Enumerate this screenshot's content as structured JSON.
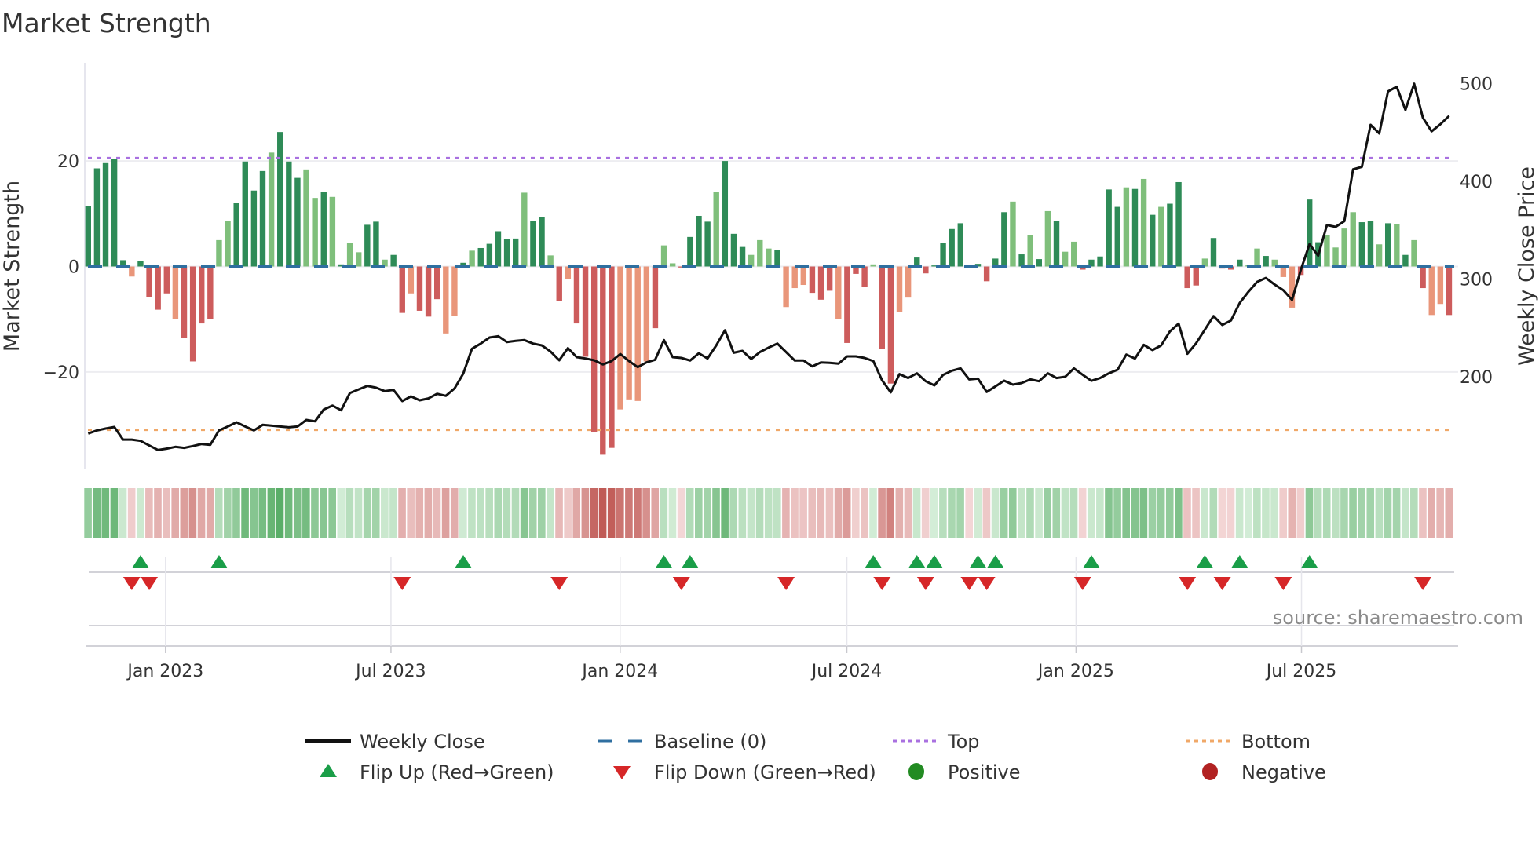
{
  "title": "Market Strength",
  "source_note": "source: sharemaestro.com",
  "colors": {
    "pos_dark": "#2e8b57",
    "pos_light": "#7fbf7b",
    "neg_dark": "#cd5c5c",
    "neg_light": "#e9967a",
    "baseline": "#2f6fa0",
    "top": "#a970e0",
    "bottom": "#f0a868",
    "close": "#111111",
    "flip_up": "#1a9e48",
    "flip_down": "#d62728",
    "positive": "#228b22",
    "negative": "#b22222"
  },
  "chart_data": {
    "type": "bar",
    "title": "Market Strength",
    "ylabel": "Market Strength",
    "y2label": "Weekly Close Price",
    "ylim": [
      -38,
      38
    ],
    "y2lim": [
      100,
      510
    ],
    "yticks": [
      {
        "value": 20,
        "label": "20"
      },
      {
        "value": 0,
        "label": "0"
      },
      {
        "value": -20,
        "label": "−20"
      }
    ],
    "y2ticks": [
      {
        "value": 500,
        "label": "500"
      },
      {
        "value": 400,
        "label": "400"
      },
      {
        "value": 300,
        "label": "300"
      },
      {
        "value": 200,
        "label": "200"
      }
    ],
    "xticks": [
      {
        "date": "2023-01-01",
        "label": "Jan 2023"
      },
      {
        "date": "2023-07-01",
        "label": "Jul 2023"
      },
      {
        "date": "2024-01-01",
        "label": "Jan 2024"
      },
      {
        "date": "2024-07-01",
        "label": "Jul 2024"
      },
      {
        "date": "2025-01-01",
        "label": "Jan 2025"
      },
      {
        "date": "2025-07-01",
        "label": "Jul 2025"
      }
    ],
    "first_week": "2022-10-31",
    "frequency": "weekly",
    "top_level": 20.6,
    "bottom_level": -31,
    "baseline": 0,
    "strength": [
      11.4,
      18.6,
      19.6,
      20.4,
      1.2,
      -1.9,
      1.0,
      -5.8,
      -8.2,
      -5.1,
      -9.9,
      -13.5,
      -18.0,
      -10.8,
      -10.0,
      5.0,
      8.7,
      12.0,
      19.9,
      14.4,
      18.1,
      21.6,
      25.5,
      19.9,
      16.8,
      18.4,
      13.0,
      14.1,
      13.2,
      0.4,
      4.4,
      2.7,
      7.9,
      8.5,
      1.3,
      2.2,
      -8.8,
      -5.1,
      -8.4,
      -9.5,
      -6.2,
      -12.7,
      -9.3,
      0.7,
      3.0,
      3.5,
      4.3,
      6.7,
      5.2,
      5.3,
      14.0,
      8.7,
      9.3,
      2.1,
      -6.5,
      -2.4,
      -10.8,
      -17.1,
      -31.4,
      -35.7,
      -34.4,
      -27.1,
      -25.2,
      -25.5,
      -18.0,
      -11.7,
      4.0,
      0.6,
      -0.2,
      5.6,
      9.6,
      8.5,
      14.2,
      20.0,
      6.2,
      3.7,
      2.2,
      5.0,
      3.4,
      3.1,
      -7.7,
      -4.1,
      -3.5,
      -5.0,
      -6.3,
      -4.6,
      -10.0,
      -14.5,
      -1.4,
      -3.9,
      0.4,
      -15.7,
      -22.2,
      -8.7,
      -5.9,
      1.7,
      -1.3,
      0.2,
      4.4,
      7.1,
      8.2,
      -0.2,
      0.5,
      -2.8,
      1.5,
      10.3,
      12.3,
      2.3,
      5.9,
      1.4,
      10.5,
      8.7,
      2.8,
      4.7,
      -0.6,
      1.3,
      1.9,
      14.6,
      11.3,
      15.0,
      14.7,
      16.6,
      9.8,
      11.3,
      11.9,
      16.0,
      -4.1,
      -3.6,
      1.5,
      5.4,
      -0.4,
      -0.6,
      1.3,
      0.3,
      3.4,
      2.0,
      1.3,
      -2.0,
      -7.8,
      -1.6,
      12.7,
      4.6,
      6.0,
      3.6,
      7.2,
      10.3,
      8.4,
      8.6,
      4.2,
      8.2,
      8.0,
      2.2,
      5.0,
      -4.1,
      -9.2,
      -7.1,
      -9.2
    ],
    "shade": "dddddlddddlddddllddddldddlldldllddlddldddlldldddddlddldldddddlllldllddddldddllldllldddldddlddlldddddddddddldldldlldddddldldlddddlddddlldllldddllllddldldldlldddldll",
    "weekly_close": [
      141.9,
      145.1,
      147.0,
      148.6,
      135.7,
      135.7,
      134.4,
      129.6,
      125.1,
      126.4,
      128.3,
      127.2,
      129.1,
      131.2,
      130.4,
      145.1,
      149.1,
      153.4,
      149.1,
      145.1,
      150.8,
      150.0,
      149.1,
      148.3,
      149.1,
      155.8,
      154.4,
      166.5,
      170.5,
      165.7,
      183.4,
      187.1,
      190.6,
      188.8,
      185.3,
      186.6,
      175.1,
      179.9,
      175.9,
      177.8,
      182.6,
      180.5,
      188.0,
      203.2,
      228.7,
      234.0,
      240.2,
      241.5,
      235.6,
      236.7,
      237.5,
      234.0,
      232.1,
      225.9,
      216.9,
      229.3,
      220.1,
      218.7,
      216.9,
      212.6,
      216.1,
      223.3,
      216.1,
      209.9,
      214.7,
      217.4,
      237.5,
      220.1,
      219.3,
      216.6,
      224.1,
      218.7,
      232.1,
      247.6,
      224.6,
      226.5,
      218.2,
      225.3,
      229.9,
      234.0,
      225.3,
      216.6,
      216.6,
      210.7,
      214.7,
      214.2,
      213.4,
      220.9,
      220.9,
      219.3,
      216.1,
      196.5,
      184.0,
      202.7,
      198.7,
      203.5,
      195.4,
      191.2,
      201.9,
      206.2,
      208.6,
      197.3,
      198.1,
      184.5,
      190.1,
      196.0,
      192.0,
      193.6,
      197.3,
      195.4,
      203.5,
      198.7,
      200.0,
      208.6,
      202.1,
      195.8,
      198.7,
      203.5,
      207.2,
      222.7,
      218.7,
      232.7,
      227.3,
      232.1,
      246.4,
      254.4,
      223.5,
      234.3,
      248.2,
      262.1,
      253.0,
      257.6,
      275.5,
      287.0,
      297.1,
      301.1,
      294.4,
      288.5,
      278.6,
      309.2,
      335.7,
      323.9,
      355.3,
      353.4,
      359.3,
      412.3,
      414.8,
      457.8,
      449.0,
      492.0,
      496.8,
      473.1,
      499.8,
      465.1,
      451.2,
      458.4,
      466.9
    ],
    "flip_up_weeks": [
      6,
      15,
      43,
      66,
      69,
      90,
      95,
      97,
      102,
      104,
      115,
      128,
      132,
      140
    ],
    "flip_down_weeks": [
      5,
      7,
      36,
      54,
      68,
      80,
      91,
      96,
      101,
      103,
      114,
      126,
      130,
      137,
      153
    ],
    "legend": [
      {
        "label": "Weekly Close",
        "kind": "line"
      },
      {
        "label": "Baseline (0)",
        "kind": "dash"
      },
      {
        "label": "Top",
        "kind": "dot-top"
      },
      {
        "label": "Bottom",
        "kind": "dot-bottom"
      },
      {
        "label": "Flip Up (Red→Green)",
        "kind": "tri-up"
      },
      {
        "label": "Flip Down (Green→Red)",
        "kind": "tri-down"
      },
      {
        "label": "Positive",
        "kind": "dot-pos"
      },
      {
        "label": "Negative",
        "kind": "dot-neg"
      }
    ],
    "legend_position": "bottom"
  }
}
